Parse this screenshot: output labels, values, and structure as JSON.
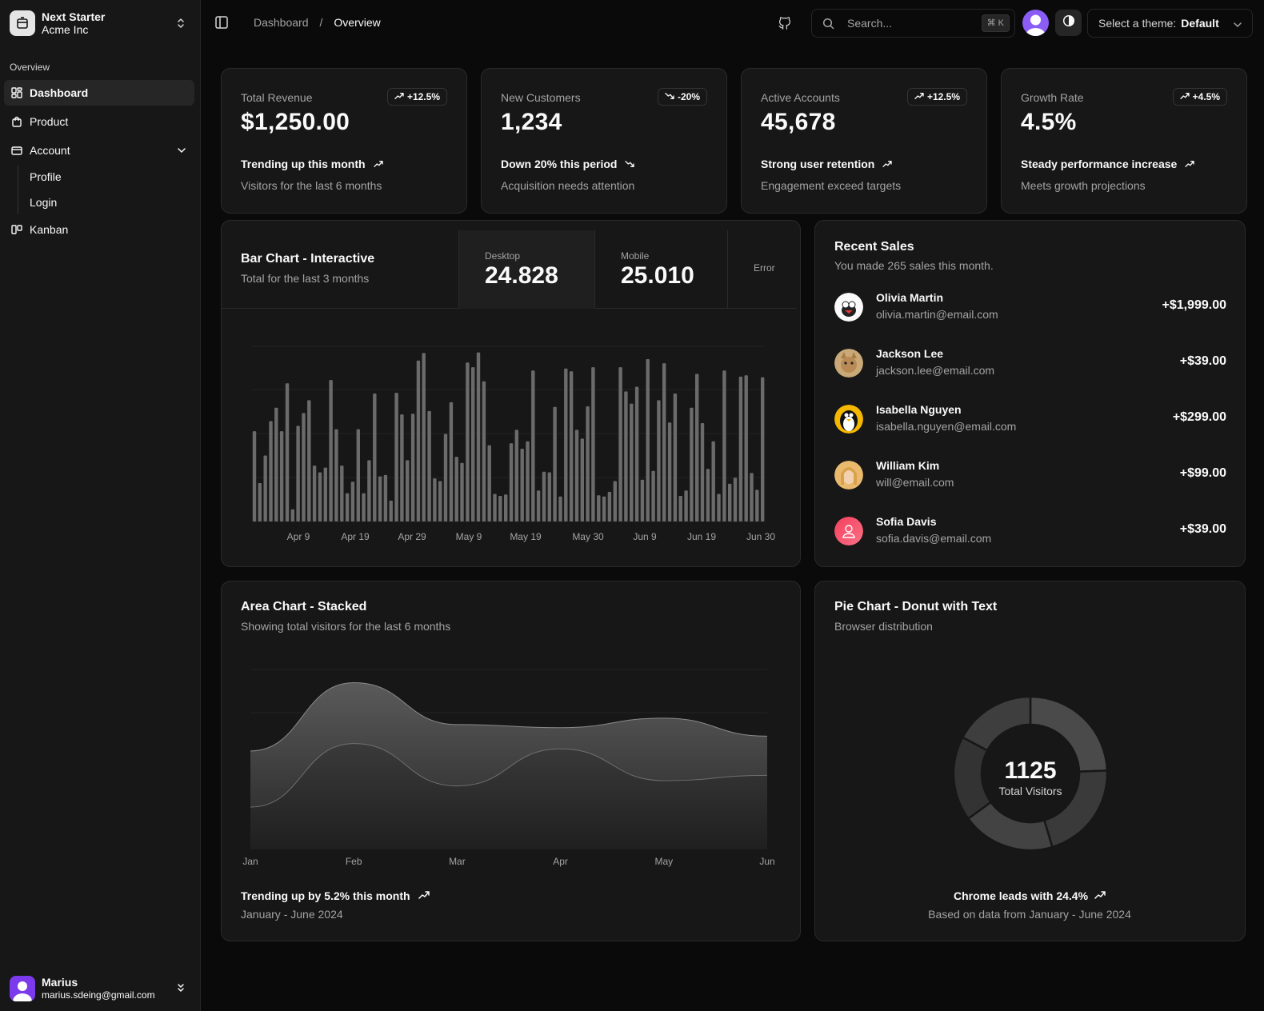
{
  "team": {
    "name": "Next Starter",
    "plan": "Acme Inc"
  },
  "sidebar": {
    "group_label": "Overview",
    "items": [
      {
        "label": "Dashboard",
        "icon": "dashboard-icon"
      },
      {
        "label": "Product",
        "icon": "shopping-bag-icon"
      },
      {
        "label": "Account",
        "icon": "credit-card-icon"
      },
      {
        "label": "Kanban",
        "icon": "kanban-icon"
      }
    ],
    "account_sub": [
      {
        "label": "Profile"
      },
      {
        "label": "Login"
      }
    ]
  },
  "user": {
    "name": "Marius",
    "email": "marius.sdeing@gmail.com"
  },
  "header": {
    "breadcrumb": [
      "Dashboard",
      "Overview"
    ],
    "breadcrumb_sep": "/",
    "search_placeholder": "Search...",
    "search_shortcut": "⌘ K",
    "theme_label": "Select a theme:",
    "theme_value": "Default"
  },
  "stats": [
    {
      "label": "Total Revenue",
      "value": "$1,250.00",
      "badge": "+12.5%",
      "badge_dir": "up",
      "trend": "Trending up this month",
      "trend_dir": "up",
      "desc": "Visitors for the last 6 months"
    },
    {
      "label": "New Customers",
      "value": "1,234",
      "badge": "-20%",
      "badge_dir": "down",
      "trend": "Down 20% this period",
      "trend_dir": "down",
      "desc": "Acquisition needs attention"
    },
    {
      "label": "Active Accounts",
      "value": "45,678",
      "badge": "+12.5%",
      "badge_dir": "up",
      "trend": "Strong user retention",
      "trend_dir": "up",
      "desc": "Engagement exceed targets"
    },
    {
      "label": "Growth Rate",
      "value": "4.5%",
      "badge": "+4.5%",
      "badge_dir": "up",
      "trend": "Steady performance increase",
      "trend_dir": "up",
      "desc": "Meets growth projections"
    }
  ],
  "bar_card": {
    "title": "Bar Chart - Interactive",
    "subtitle": "Total for the last 3 months",
    "metrics": [
      {
        "label": "Desktop",
        "value": "24.828"
      },
      {
        "label": "Mobile",
        "value": "25.010"
      },
      {
        "label": "Error"
      }
    ]
  },
  "recent_sales": {
    "title": "Recent Sales",
    "subtitle": "You made 265 sales this month.",
    "items": [
      {
        "name": "Olivia Martin",
        "email": "olivia.martin@email.com",
        "amount": "+$1,999.00"
      },
      {
        "name": "Jackson Lee",
        "email": "jackson.lee@email.com",
        "amount": "+$39.00"
      },
      {
        "name": "Isabella Nguyen",
        "email": "isabella.nguyen@email.com",
        "amount": "+$299.00"
      },
      {
        "name": "William Kim",
        "email": "will@email.com",
        "amount": "+$99.00"
      },
      {
        "name": "Sofia Davis",
        "email": "sofia.davis@email.com",
        "amount": "+$39.00"
      }
    ]
  },
  "area_card": {
    "title": "Area Chart - Stacked",
    "subtitle": "Showing total visitors for the last 6 months",
    "footer_trend": "Trending up by 5.2% this month",
    "footer_range": "January - June 2024"
  },
  "pie_card": {
    "title": "Pie Chart - Donut with Text",
    "subtitle": "Browser distribution",
    "center_value": "1125",
    "center_label": "Total Visitors",
    "footer_trend": "Chrome leads with 24.4%",
    "footer_range": "Based on data from January - June 2024"
  },
  "colors": {
    "background": "#0a0a0a",
    "card": "#171717",
    "border": "#2a2a2a",
    "muted_text": "#a3a3a3",
    "bar": "#6b6b6b",
    "avatar_accent": "#8b5cf6"
  },
  "chart_data": [
    {
      "type": "bar",
      "title": "Bar Chart - Interactive",
      "x_ticks": [
        "Apr 9",
        "Apr 19",
        "Apr 29",
        "May 9",
        "May 19",
        "May 30",
        "Jun 9",
        "Jun 19",
        "Jun 30"
      ],
      "series": [
        {
          "name": "Desktop",
          "values": [
            134,
            57,
            98,
            149,
            169,
            134,
            205,
            18,
            142,
            161,
            180,
            83,
            73,
            80,
            210,
            137,
            83,
            42,
            59,
            137,
            42,
            91,
            190,
            67,
            69,
            31,
            191,
            159,
            91,
            160,
            239,
            250,
            164,
            64,
            60,
            130,
            177,
            96,
            87,
            236,
            229,
            251,
            208,
            113,
            41,
            38,
            40,
            116,
            136,
            108,
            119,
            224,
            46,
            74,
            73,
            170,
            37,
            227,
            223,
            136,
            123,
            171,
            229,
            39,
            37,
            44,
            60,
            229,
            193,
            175,
            200,
            62,
            241,
            75,
            180,
            235,
            147,
            190,
            38,
            46,
            169,
            219,
            146,
            78,
            119,
            41,
            224,
            56,
            65,
            215,
            217,
            72,
            47,
            214
          ]
        }
      ],
      "grid": true,
      "legend": "none"
    },
    {
      "type": "area",
      "title": "Area Chart - Stacked",
      "categories": [
        "Jan",
        "Feb",
        "Mar",
        "Apr",
        "May",
        "Jun"
      ],
      "series": [
        {
          "values": [
            80,
            200,
            120,
            190,
            130,
            140
          ]
        },
        {
          "values": [
            106,
            115,
            116,
            40,
            118,
            74
          ]
        }
      ],
      "grid": true,
      "legend": "none"
    },
    {
      "type": "pie",
      "title": "Pie Chart - Donut with Text",
      "values": [
        24.4,
        21.0,
        19.6,
        17.8,
        17.2
      ],
      "center_text": "1125 Total Visitors"
    }
  ]
}
